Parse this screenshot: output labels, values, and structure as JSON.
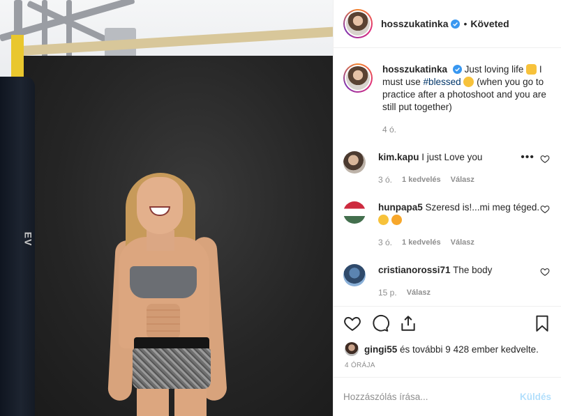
{
  "post": {
    "author": "hosszukatinka",
    "follow_status": "Követed",
    "separator": "•",
    "photo_text": "EV"
  },
  "caption": {
    "username": "hosszukatinka",
    "text_1": "Just loving life",
    "text_2": "I must use",
    "hashtag": "#blessed",
    "text_3": "(when you go to practice after a photoshoot and you are still put together)",
    "time": "4 ó."
  },
  "comments": [
    {
      "username": "kim.kapu",
      "text": "I just Love you",
      "time": "3 ó.",
      "likes": "1 kedvelés",
      "reply": "Válasz"
    },
    {
      "username": "hunpapa5",
      "text": "Szeresd is!...mi meg téged.",
      "time": "3 ó.",
      "likes": "1 kedvelés",
      "reply": "Válasz"
    },
    {
      "username": "cristianorossi71",
      "text": "The body",
      "time": "15 p.",
      "reply": "Válasz"
    }
  ],
  "more_label": "•••",
  "likes": {
    "user": "gingi55",
    "rest": " és további 9 428 ember kedvelte."
  },
  "time_ago": "4 ÓRÁJA",
  "add_comment": {
    "placeholder": "Hozzászólás írása...",
    "post_label": "Küldés"
  },
  "colors": {
    "verified": "#3897f0",
    "hashtag": "#003569",
    "muted": "#8e8e8e",
    "post_disabled": "#b2dffc"
  },
  "icons": [
    "heart-icon",
    "comment-icon",
    "share-icon",
    "bookmark-icon",
    "verified-badge-icon"
  ]
}
